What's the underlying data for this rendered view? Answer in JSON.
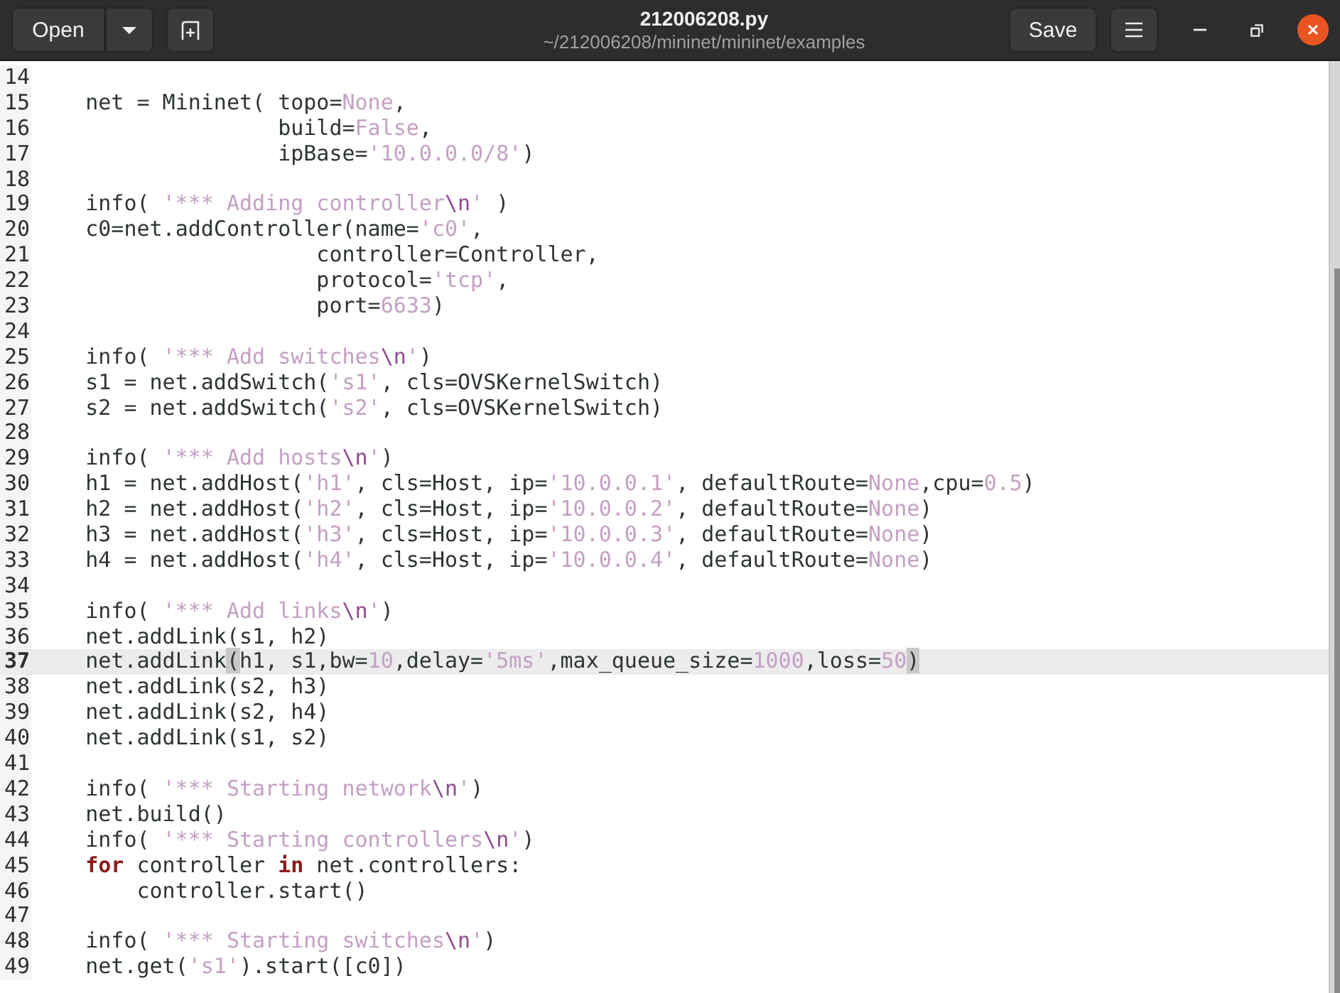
{
  "window": {
    "title": "212006208.py",
    "subtitle": "~/212006208/mininet/mininet/examples"
  },
  "header_buttons": {
    "open": "Open",
    "save": "Save"
  },
  "editor": {
    "lines": [
      {
        "number": "14",
        "current": false
      },
      {
        "number": "15",
        "current": false,
        "tokens": [
          {
            "kind": "plain",
            "text": "    net = Mininet( topo="
          },
          {
            "kind": "const",
            "text": "None"
          },
          {
            "kind": "plain",
            "text": ","
          }
        ]
      },
      {
        "number": "16",
        "current": false,
        "tokens": [
          {
            "kind": "plain",
            "text": "                   build="
          },
          {
            "kind": "const",
            "text": "False"
          },
          {
            "kind": "plain",
            "text": ","
          }
        ]
      },
      {
        "number": "17",
        "current": false,
        "tokens": [
          {
            "kind": "plain",
            "text": "                   ipBase="
          },
          {
            "kind": "string",
            "text": "'10.0.0.0/8'"
          },
          {
            "kind": "plain",
            "text": ")"
          }
        ]
      },
      {
        "number": "18",
        "current": false
      },
      {
        "number": "19",
        "current": false,
        "tokens": [
          {
            "kind": "plain",
            "text": "    info( "
          },
          {
            "kind": "string",
            "text": "'*** Adding controller"
          },
          {
            "kind": "escape",
            "text": "\\n"
          },
          {
            "kind": "string",
            "text": "'"
          },
          {
            "kind": "plain",
            "text": " )"
          }
        ]
      },
      {
        "number": "20",
        "current": false,
        "tokens": [
          {
            "kind": "plain",
            "text": "    c0=net.addController(name="
          },
          {
            "kind": "string",
            "text": "'c0'"
          },
          {
            "kind": "plain",
            "text": ","
          }
        ]
      },
      {
        "number": "21",
        "current": false,
        "tokens": [
          {
            "kind": "plain",
            "text": "                      controller=Controller,"
          }
        ]
      },
      {
        "number": "22",
        "current": false,
        "tokens": [
          {
            "kind": "plain",
            "text": "                      protocol="
          },
          {
            "kind": "string",
            "text": "'tcp'"
          },
          {
            "kind": "plain",
            "text": ","
          }
        ]
      },
      {
        "number": "23",
        "current": false,
        "tokens": [
          {
            "kind": "plain",
            "text": "                      port="
          },
          {
            "kind": "number",
            "text": "6633"
          },
          {
            "kind": "plain",
            "text": ")"
          }
        ]
      },
      {
        "number": "24",
        "current": false
      },
      {
        "number": "25",
        "current": false,
        "tokens": [
          {
            "kind": "plain",
            "text": "    info( "
          },
          {
            "kind": "string",
            "text": "'*** Add switches"
          },
          {
            "kind": "escape",
            "text": "\\n"
          },
          {
            "kind": "string",
            "text": "'"
          },
          {
            "kind": "plain",
            "text": ")"
          }
        ]
      },
      {
        "number": "26",
        "current": false,
        "tokens": [
          {
            "kind": "plain",
            "text": "    s1 = net.addSwitch("
          },
          {
            "kind": "string",
            "text": "'s1'"
          },
          {
            "kind": "plain",
            "text": ", cls=OVSKernelSwitch)"
          }
        ]
      },
      {
        "number": "27",
        "current": false,
        "tokens": [
          {
            "kind": "plain",
            "text": "    s2 = net.addSwitch("
          },
          {
            "kind": "string",
            "text": "'s2'"
          },
          {
            "kind": "plain",
            "text": ", cls=OVSKernelSwitch)"
          }
        ]
      },
      {
        "number": "28",
        "current": false
      },
      {
        "number": "29",
        "current": false,
        "tokens": [
          {
            "kind": "plain",
            "text": "    info( "
          },
          {
            "kind": "string",
            "text": "'*** Add hosts"
          },
          {
            "kind": "escape",
            "text": "\\n"
          },
          {
            "kind": "string",
            "text": "'"
          },
          {
            "kind": "plain",
            "text": ")"
          }
        ]
      },
      {
        "number": "30",
        "current": false,
        "tokens": [
          {
            "kind": "plain",
            "text": "    h1 = net.addHost("
          },
          {
            "kind": "string",
            "text": "'h1'"
          },
          {
            "kind": "plain",
            "text": ", cls=Host, ip="
          },
          {
            "kind": "string",
            "text": "'10.0.0.1'"
          },
          {
            "kind": "plain",
            "text": ", defaultRoute="
          },
          {
            "kind": "const",
            "text": "None"
          },
          {
            "kind": "plain",
            "text": ",cpu="
          },
          {
            "kind": "number",
            "text": "0.5"
          },
          {
            "kind": "plain",
            "text": ")"
          }
        ]
      },
      {
        "number": "31",
        "current": false,
        "tokens": [
          {
            "kind": "plain",
            "text": "    h2 = net.addHost("
          },
          {
            "kind": "string",
            "text": "'h2'"
          },
          {
            "kind": "plain",
            "text": ", cls=Host, ip="
          },
          {
            "kind": "string",
            "text": "'10.0.0.2'"
          },
          {
            "kind": "plain",
            "text": ", defaultRoute="
          },
          {
            "kind": "const",
            "text": "None"
          },
          {
            "kind": "plain",
            "text": ")"
          }
        ]
      },
      {
        "number": "32",
        "current": false,
        "tokens": [
          {
            "kind": "plain",
            "text": "    h3 = net.addHost("
          },
          {
            "kind": "string",
            "text": "'h3'"
          },
          {
            "kind": "plain",
            "text": ", cls=Host, ip="
          },
          {
            "kind": "string",
            "text": "'10.0.0.3'"
          },
          {
            "kind": "plain",
            "text": ", defaultRoute="
          },
          {
            "kind": "const",
            "text": "None"
          },
          {
            "kind": "plain",
            "text": ")"
          }
        ]
      },
      {
        "number": "33",
        "current": false,
        "tokens": [
          {
            "kind": "plain",
            "text": "    h4 = net.addHost("
          },
          {
            "kind": "string",
            "text": "'h4'"
          },
          {
            "kind": "plain",
            "text": ", cls=Host, ip="
          },
          {
            "kind": "string",
            "text": "'10.0.0.4'"
          },
          {
            "kind": "plain",
            "text": ", defaultRoute="
          },
          {
            "kind": "const",
            "text": "None"
          },
          {
            "kind": "plain",
            "text": ")"
          }
        ]
      },
      {
        "number": "34",
        "current": false
      },
      {
        "number": "35",
        "current": false,
        "tokens": [
          {
            "kind": "plain",
            "text": "    info( "
          },
          {
            "kind": "string",
            "text": "'*** Add links"
          },
          {
            "kind": "escape",
            "text": "\\n"
          },
          {
            "kind": "string",
            "text": "'"
          },
          {
            "kind": "plain",
            "text": ")"
          }
        ]
      },
      {
        "number": "36",
        "current": false,
        "tokens": [
          {
            "kind": "plain",
            "text": "    net.addLink(s1, h2)"
          }
        ]
      },
      {
        "number": "37",
        "current": true,
        "tokens": [
          {
            "kind": "plain",
            "text": "    net.addLink"
          },
          {
            "kind": "bracket",
            "text": "("
          },
          {
            "kind": "plain",
            "text": "h1, s1,bw="
          },
          {
            "kind": "number",
            "text": "10"
          },
          {
            "kind": "plain",
            "text": ",delay="
          },
          {
            "kind": "string",
            "text": "'5ms'"
          },
          {
            "kind": "plain",
            "text": ",max_queue_size="
          },
          {
            "kind": "number",
            "text": "1000"
          },
          {
            "kind": "plain",
            "text": ",loss="
          },
          {
            "kind": "number",
            "text": "50"
          },
          {
            "kind": "bracket",
            "text": ")"
          }
        ]
      },
      {
        "number": "38",
        "current": false,
        "tokens": [
          {
            "kind": "plain",
            "text": "    net.addLink(s2, h3)"
          }
        ]
      },
      {
        "number": "39",
        "current": false,
        "tokens": [
          {
            "kind": "plain",
            "text": "    net.addLink(s2, h4)"
          }
        ]
      },
      {
        "number": "40",
        "current": false,
        "tokens": [
          {
            "kind": "plain",
            "text": "    net.addLink(s1, s2)"
          }
        ]
      },
      {
        "number": "41",
        "current": false
      },
      {
        "number": "42",
        "current": false,
        "tokens": [
          {
            "kind": "plain",
            "text": "    info( "
          },
          {
            "kind": "string",
            "text": "'*** Starting network"
          },
          {
            "kind": "escape",
            "text": "\\n"
          },
          {
            "kind": "string",
            "text": "'"
          },
          {
            "kind": "plain",
            "text": ")"
          }
        ]
      },
      {
        "number": "43",
        "current": false,
        "tokens": [
          {
            "kind": "plain",
            "text": "    net.build()"
          }
        ]
      },
      {
        "number": "44",
        "current": false,
        "tokens": [
          {
            "kind": "plain",
            "text": "    info( "
          },
          {
            "kind": "string",
            "text": "'*** Starting controllers"
          },
          {
            "kind": "escape",
            "text": "\\n"
          },
          {
            "kind": "string",
            "text": "'"
          },
          {
            "kind": "plain",
            "text": ")"
          }
        ]
      },
      {
        "number": "45",
        "current": false,
        "tokens": [
          {
            "kind": "keyword",
            "text": "    for"
          },
          {
            "kind": "plain",
            "text": " controller "
          },
          {
            "kind": "keyword",
            "text": "in"
          },
          {
            "kind": "plain",
            "text": " net.controllers:"
          }
        ]
      },
      {
        "number": "46",
        "current": false,
        "tokens": [
          {
            "kind": "plain",
            "text": "        controller.start()"
          }
        ]
      },
      {
        "number": "47",
        "current": false
      },
      {
        "number": "48",
        "current": false,
        "tokens": [
          {
            "kind": "plain",
            "text": "    info( "
          },
          {
            "kind": "string",
            "text": "'*** Starting switches"
          },
          {
            "kind": "escape",
            "text": "\\n"
          },
          {
            "kind": "string",
            "text": "'"
          },
          {
            "kind": "plain",
            "text": ")"
          }
        ]
      },
      {
        "number": "49",
        "current": false,
        "tokens": [
          {
            "kind": "plain",
            "text": "    net.get("
          },
          {
            "kind": "string",
            "text": "'s1'"
          },
          {
            "kind": "plain",
            "text": ").start([c0])"
          }
        ]
      }
    ]
  }
}
